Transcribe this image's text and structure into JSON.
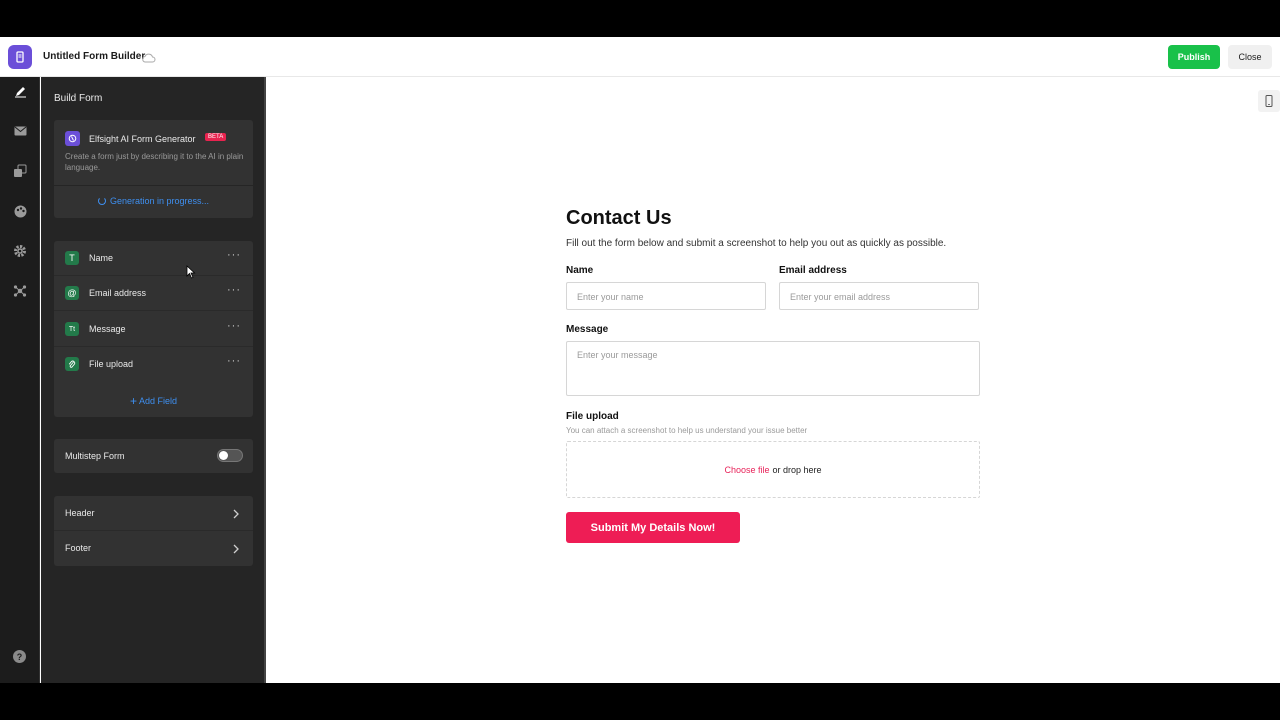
{
  "header": {
    "app_title": "Untitled Form Builder",
    "publish_label": "Publish",
    "close_label": "Close"
  },
  "rail": {
    "icons": [
      "pencil-icon",
      "mail-icon",
      "layers-icon",
      "palette-icon",
      "gear-icon",
      "plugin-icon",
      "help-icon"
    ]
  },
  "panel": {
    "title": "Build Form",
    "ai": {
      "title": "Elfsight AI Form Generator",
      "badge": "BETA",
      "description": "Create a form just by describing it to the AI in plain language.",
      "status": "Generation in progress..."
    },
    "fields": [
      {
        "label": "Name",
        "icon": "T"
      },
      {
        "label": "Email address",
        "icon": "@"
      },
      {
        "label": "Message",
        "icon": "Tt"
      },
      {
        "label": "File upload",
        "icon": "paperclip"
      }
    ],
    "add_field_label": "Add Field",
    "multistep_label": "Multistep Form",
    "multistep_enabled": false,
    "header_label": "Header",
    "footer_label": "Footer"
  },
  "form": {
    "title": "Contact Us",
    "subtitle": "Fill out the form below and submit a screenshot to help you out as quickly as possible.",
    "name_label": "Name",
    "name_placeholder": "Enter your name",
    "email_label": "Email address",
    "email_placeholder": "Enter your email address",
    "message_label": "Message",
    "message_placeholder": "Enter your message",
    "upload_label": "File upload",
    "upload_hint": "You can attach a screenshot to help us understand your issue better",
    "choose_file": "Choose file",
    "drop_text": "or drop here",
    "submit_label": "Submit My Details Now!"
  },
  "colors": {
    "accent_publish": "#19c14a",
    "submit": "#ee1d55",
    "link_blue": "#3e8ff0",
    "brand_purple": "#6b4fd8"
  }
}
